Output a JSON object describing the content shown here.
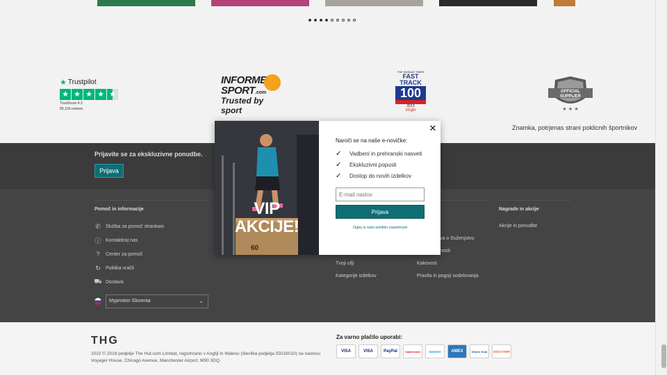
{
  "trust": {
    "trustpilot": {
      "brand": "Trustpilot",
      "score": "TrustScore 4.3",
      "reviews": "83,118 reviews"
    },
    "informed_sport": {
      "line1": "INFORMED-",
      "line2": "SPORT",
      "com": ".com",
      "tagline": "Trusted by sport"
    },
    "fast_track": {
      "top": "THE SUNDAY TIMES",
      "name": "FAST TRACK",
      "number": "100",
      "year": "2013",
      "sponsor": "Virgin"
    },
    "supplier": {
      "badge_line1": "OFFICIAL",
      "badge_line2": "SUPPLIER",
      "text": "Znamka, potrjenas strani poklicnih športnikov"
    }
  },
  "newsletter_bar": {
    "title": "Prijavite se za ekskluzivne ponudbe.",
    "button": "Prijava"
  },
  "footer": {
    "help_heading": "Pomoč in informacije",
    "help_items": [
      {
        "label": "Služba za pomoč strankam",
        "icon": "phone-icon"
      },
      {
        "label": "Kontaktiraj nas",
        "icon": "info-icon"
      },
      {
        "label": "Center za pomoč",
        "icon": "question-icon"
      },
      {
        "label": "Politika vračil",
        "icon": "refresh-icon"
      },
      {
        "label": "Dostava",
        "icon": "truck-icon"
      }
    ],
    "col3_links": [
      "Tvoji cilji",
      "Kategorije izdelkov"
    ],
    "col4_links": [
      "va o Suženjstvu",
      "nosti",
      "Kakovost",
      "Pravila in pogoji sodelovanja"
    ],
    "rewards_heading": "Nagrade in akcije",
    "rewards_links": [
      "Akcije in ponudbe"
    ],
    "region": "Myprotein Slovenia"
  },
  "legal": {
    "logo": "THG",
    "copyright": "2022 © 2018 podjetje The Hut.com Limited, registrirano v Angliji in Walesu (številka podjetja 05016010) na naslovu Voyager House, Chicago Avenue, Manchester Airport, M90 3DQ.",
    "payment_title": "Za varno plačilo uporabi:",
    "cards": [
      "VISA",
      "VISA",
      "PayPal",
      "mastercard",
      "maestro",
      "AMEX",
      "Diners Club",
      "DISCOVER"
    ]
  },
  "modal": {
    "title": "Naroči se na naše e-novičke:",
    "benefits": [
      "Vadbeni in prehranski nasveti",
      "Ekskluzivni popusti",
      "Dostop do novih izdelkov"
    ],
    "email_placeholder": "E-mail naslov",
    "submit": "Prijava",
    "privacy": "Oglej si našo politiko zasebnosti",
    "promo_line1": "VIP",
    "promo_line2": "AKCIJE!",
    "close_symbol": "✕"
  },
  "colors": {
    "accent": "#0f6e75",
    "footer_bg": "#444444",
    "news_bg": "#3b3b3b",
    "trustpilot": "#00b67a"
  }
}
